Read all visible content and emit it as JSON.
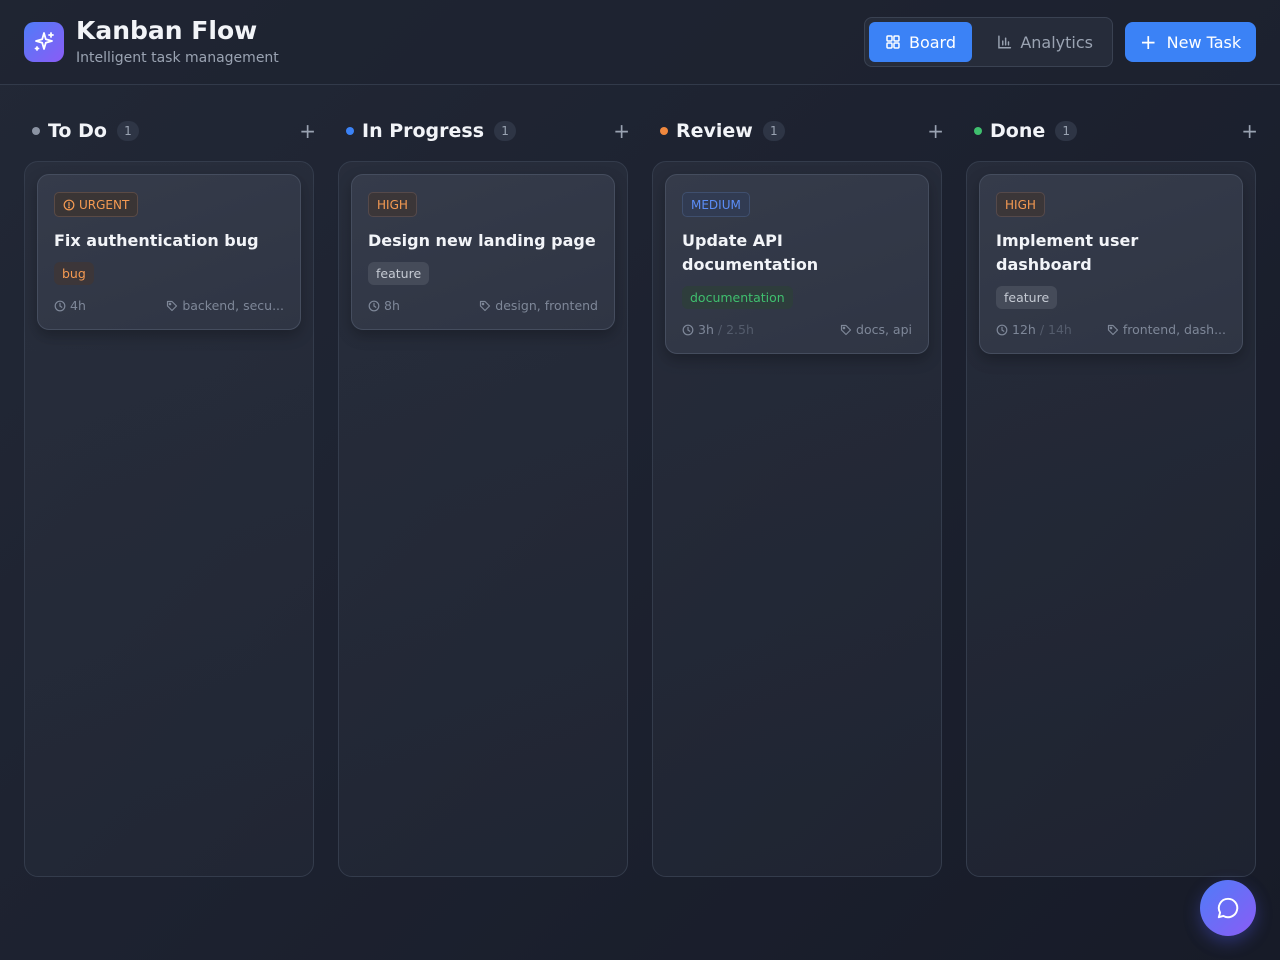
{
  "app": {
    "title": "Kanban Flow",
    "subtitle": "Intelligent task management",
    "logo_icon": "sparkles-icon",
    "accent": "#3b82f6"
  },
  "views": {
    "board_label": "Board",
    "analytics_label": "Analytics",
    "active": "Board"
  },
  "new_task_label": "New Task",
  "columns": [
    {
      "title": "To Do",
      "count": "1",
      "dot_color": "#8b93a3",
      "cards": [
        {
          "priority": "URGENT",
          "title": "Fix authentication bug",
          "label": "bug",
          "time": "4h",
          "estimate": "",
          "tags": "backend, secu..."
        }
      ]
    },
    {
      "title": "In Progress",
      "count": "1",
      "dot_color": "#3b82f6",
      "cards": [
        {
          "priority": "HIGH",
          "title": "Design new landing page",
          "label": "feature",
          "time": "8h",
          "estimate": "",
          "tags": "design, frontend"
        }
      ]
    },
    {
      "title": "Review",
      "count": "1",
      "dot_color": "#f0883e",
      "cards": [
        {
          "priority": "MEDIUM",
          "title": "Update API documentation",
          "label": "documentation",
          "time": "3h",
          "estimate": "/ 2.5h",
          "tags": "docs, api"
        }
      ]
    },
    {
      "title": "Done",
      "count": "1",
      "dot_color": "#3fbf6e",
      "cards": [
        {
          "priority": "HIGH",
          "title": "Implement user dashboard",
          "label": "feature",
          "time": "12h",
          "estimate": "/ 14h",
          "tags": "frontend, dash..."
        }
      ]
    }
  ]
}
